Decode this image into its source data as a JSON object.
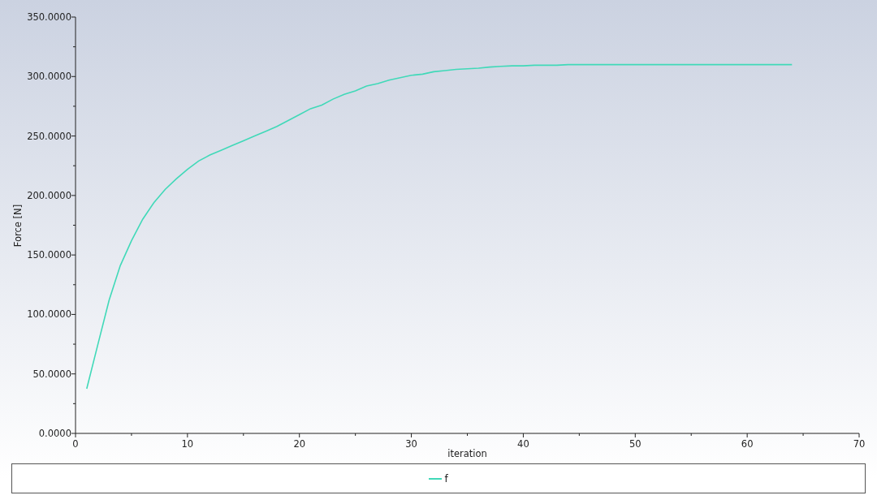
{
  "chart": {
    "chart_data": {
      "type": "line",
      "xlabel": "iteration",
      "ylabel": "Force [N]",
      "x": [
        1,
        2,
        3,
        4,
        5,
        6,
        7,
        8,
        9,
        10,
        11,
        12,
        13,
        14,
        15,
        16,
        17,
        18,
        19,
        20,
        21,
        22,
        23,
        24,
        25,
        26,
        27,
        28,
        29,
        30,
        31,
        32,
        33,
        34,
        35,
        36,
        37,
        38,
        39,
        40,
        41,
        42,
        43,
        44,
        45,
        46,
        47,
        48,
        49,
        50,
        51,
        52,
        53,
        54,
        55,
        56,
        57,
        58,
        59,
        60,
        61,
        62,
        63,
        64
      ],
      "series": [
        {
          "name": "f",
          "color": "#40d9b8",
          "values": [
            37.5,
            75,
            112,
            141,
            162,
            180,
            194,
            205,
            214,
            222,
            229,
            234,
            238,
            242,
            246,
            250,
            254,
            258,
            263,
            268,
            273,
            276,
            281,
            285,
            288,
            292,
            294,
            297,
            299,
            301,
            302,
            304,
            305,
            306,
            306.5,
            307,
            308,
            308.5,
            309,
            309,
            309.5,
            309.5,
            309.5,
            310,
            310,
            310,
            310,
            310,
            310,
            310,
            310,
            310,
            310,
            310,
            310,
            310,
            310,
            310,
            310,
            310,
            310,
            310,
            310,
            310
          ]
        }
      ],
      "xlim": [
        0,
        70
      ],
      "ylim": [
        0,
        350
      ],
      "xticks": [
        0,
        10,
        20,
        30,
        40,
        50,
        60,
        70
      ],
      "yticks": [
        {
          "value": 0,
          "label": "0.0000"
        },
        {
          "value": 50,
          "label": "50.0000"
        },
        {
          "value": 100,
          "label": "100.0000"
        },
        {
          "value": 150,
          "label": "150.0000"
        },
        {
          "value": 200,
          "label": "200.0000"
        },
        {
          "value": 250,
          "label": "250.0000"
        },
        {
          "value": 300,
          "label": "300.0000"
        },
        {
          "value": 350,
          "label": "350.0000"
        }
      ]
    }
  }
}
